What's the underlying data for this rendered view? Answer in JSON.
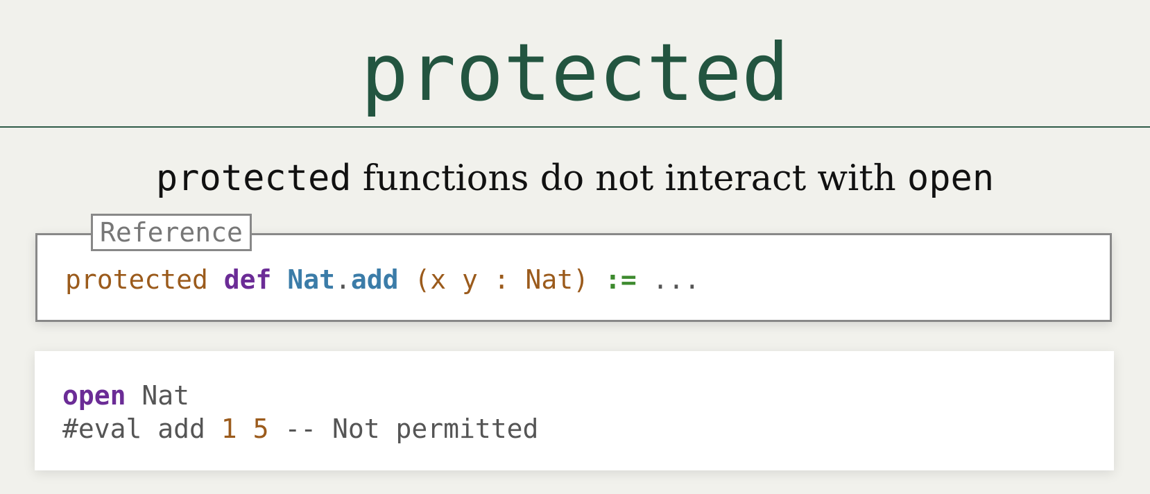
{
  "page": {
    "title": "protected"
  },
  "subtitle": {
    "code_left": "protected",
    "text": " functions do not interact with ",
    "code_right": "open"
  },
  "reference": {
    "label": "Reference",
    "tokens": {
      "protected": "protected",
      "def": "def",
      "ns": "Nat",
      "dot": ".",
      "fn": "add",
      "sig": "(x y : Nat)",
      "assign": ":=",
      "body": "..."
    }
  },
  "example": {
    "line1": {
      "keyword": "open",
      "rest": "Nat"
    },
    "line2": {
      "cmd": "#eval add",
      "num1": "1",
      "num2": "5",
      "comment": "-- Not permitted"
    }
  },
  "colors": {
    "title": "#235540",
    "keyword_orange": "#9b5b1c",
    "keyword_purple": "#6b2c96",
    "name_blue": "#3b7ca8",
    "operator_green": "#3d8a2e",
    "background": "#f1f1ec"
  }
}
